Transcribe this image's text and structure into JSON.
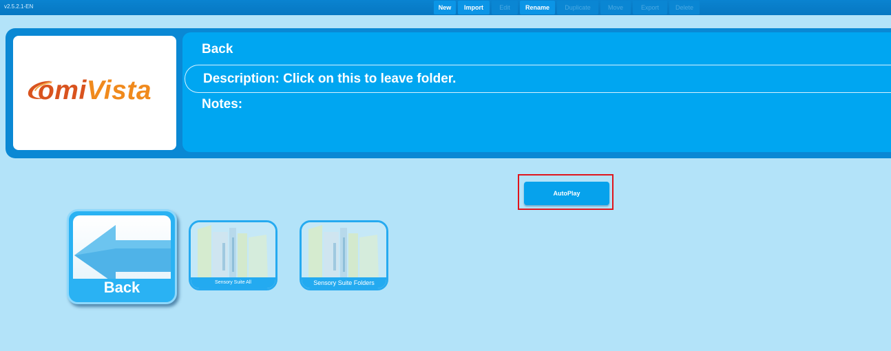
{
  "app": {
    "version": "v2.5.2.1-EN"
  },
  "toolbar": {
    "buttons": [
      {
        "label": "New",
        "enabled": true
      },
      {
        "label": "Import",
        "enabled": true
      },
      {
        "label": "Edit",
        "enabled": false
      },
      {
        "label": "Rename",
        "enabled": true
      },
      {
        "label": "Duplicate",
        "enabled": false
      },
      {
        "label": "Move",
        "enabled": false
      },
      {
        "label": "Export",
        "enabled": false
      },
      {
        "label": "Delete",
        "enabled": false
      }
    ]
  },
  "logo": {
    "part1": "omi",
    "part2": "Vista"
  },
  "details": {
    "name": "Back",
    "description": "Description: Click on this to leave folder.",
    "notes": "Notes:"
  },
  "autoplay": {
    "label": "AutoPlay"
  },
  "tiles": [
    {
      "label": "Back",
      "icon": "back-arrow-icon"
    },
    {
      "label": "Sensory Suite All",
      "icon": "folder-icon"
    },
    {
      "label": "Sensory Suite Folders",
      "icon": "folder-icon"
    }
  ],
  "colors": {
    "toolbar": "#0a83d0",
    "background": "#b3e3f9",
    "panel": "#0a88d4",
    "details": "#00a6f1",
    "highlight": "#e0141b",
    "logo_orange": "#d9531e"
  }
}
